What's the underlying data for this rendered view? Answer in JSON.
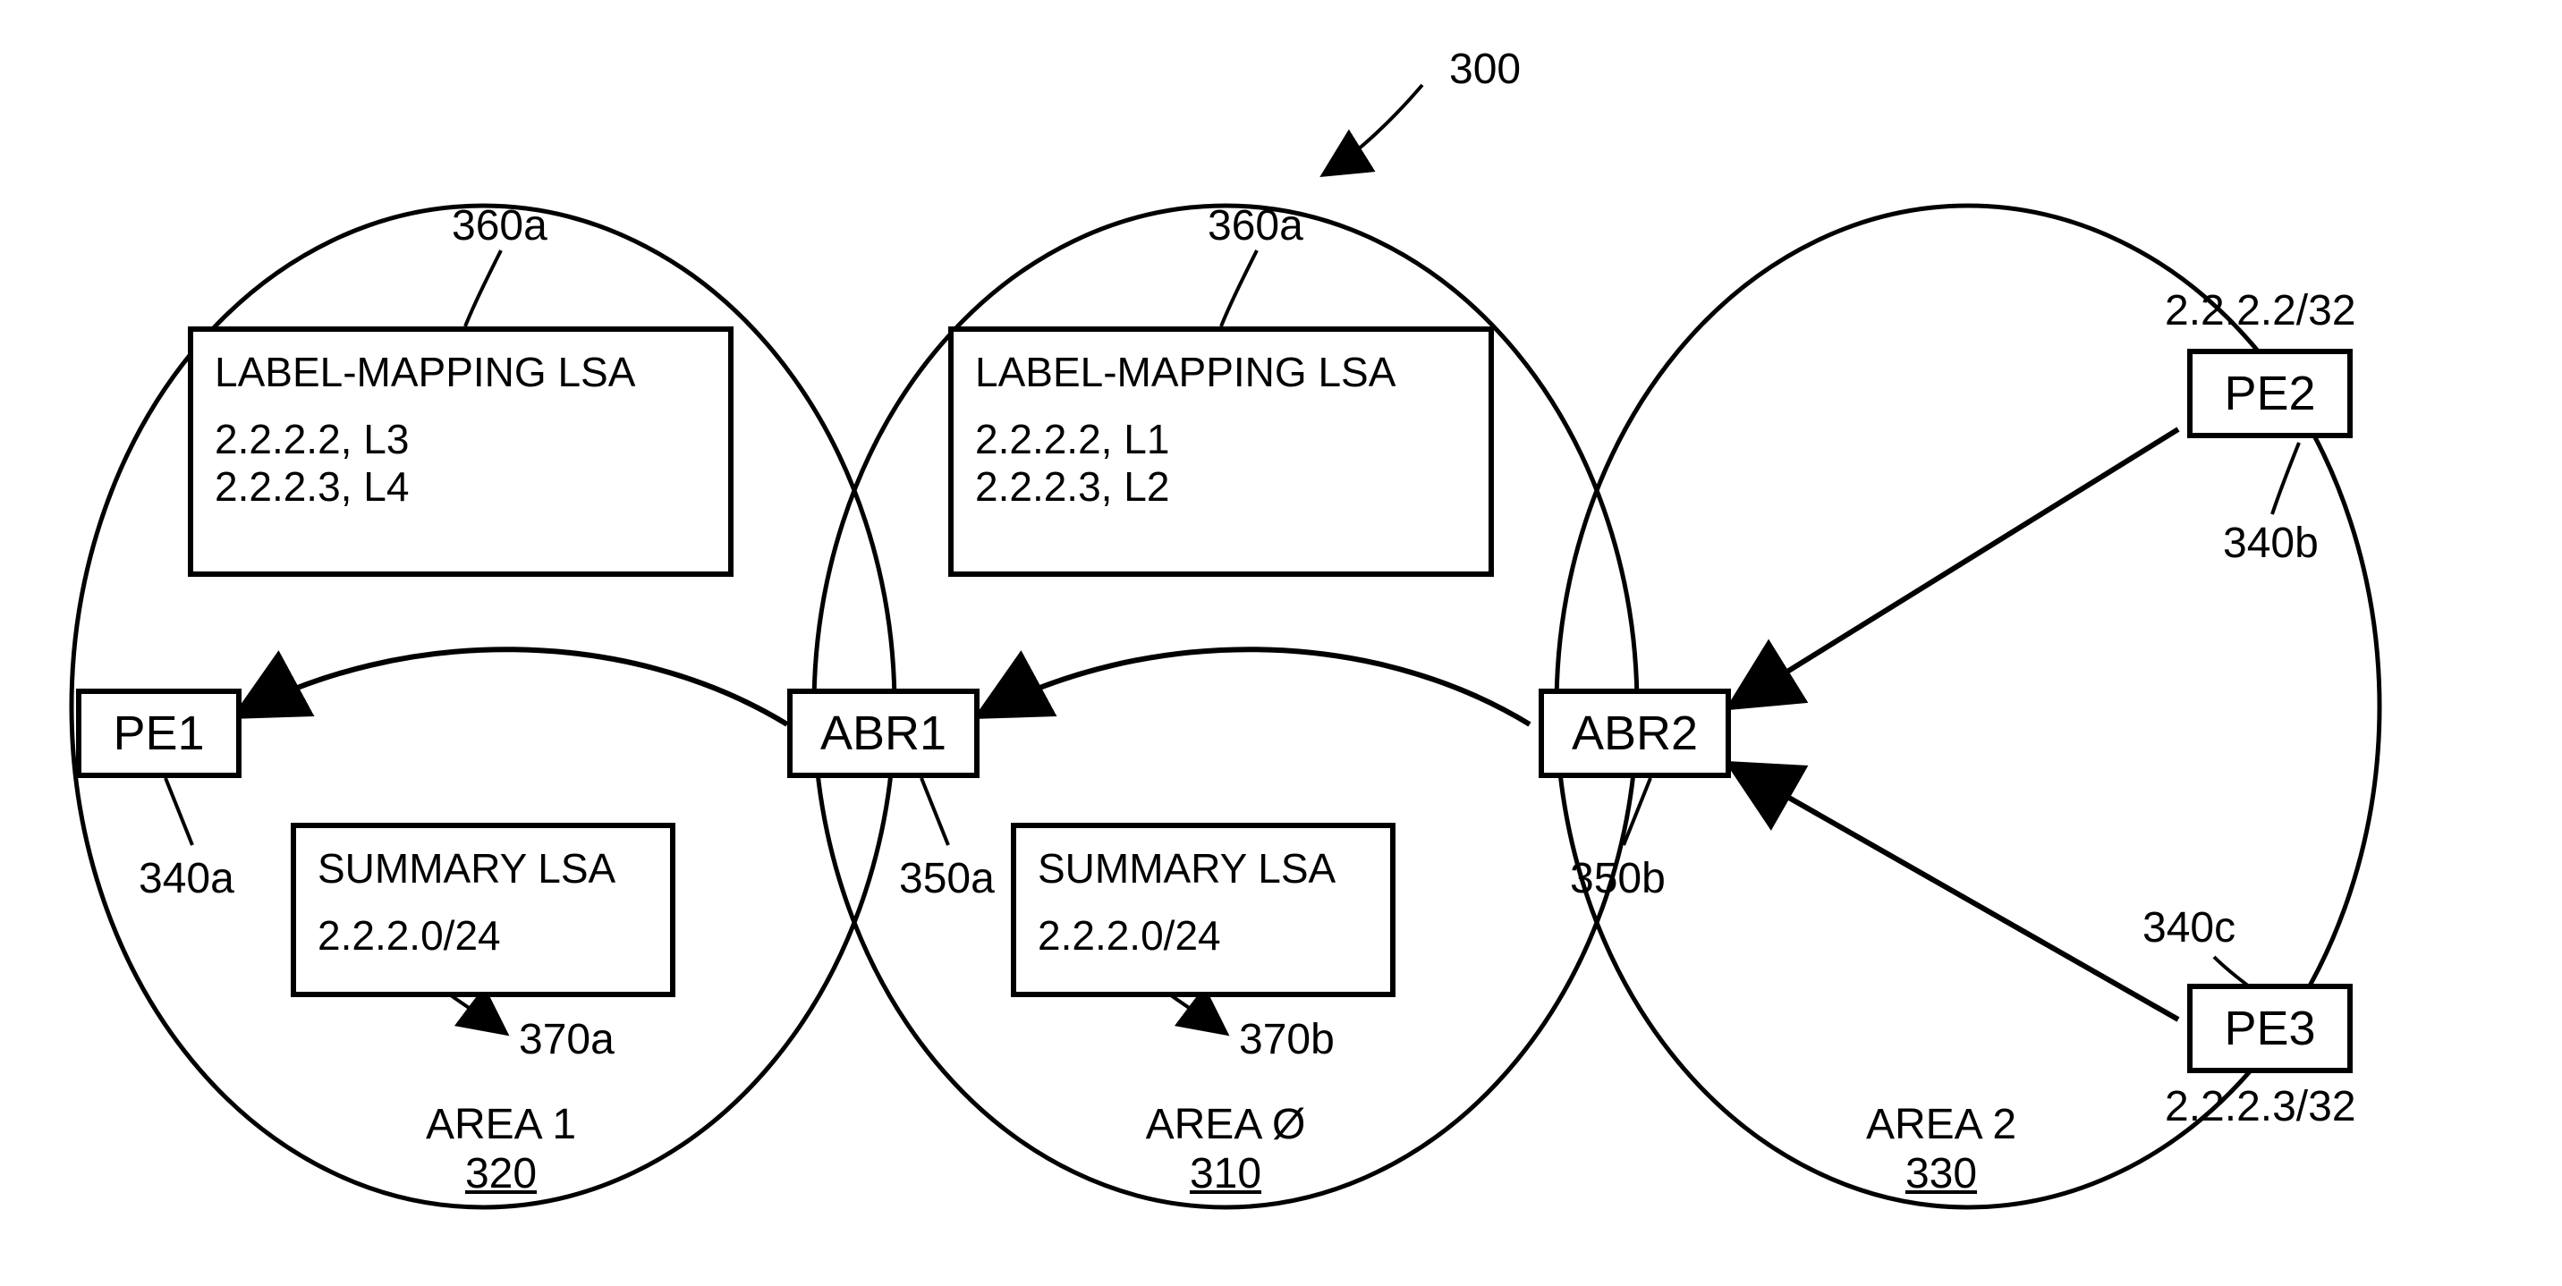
{
  "figure_id": "300",
  "areas": {
    "area1": {
      "name": "AREA 1",
      "id": "320"
    },
    "area0": {
      "name": "AREA Ø",
      "id": "310"
    },
    "area2": {
      "name": "AREA 2",
      "id": "330"
    }
  },
  "nodes": {
    "pe1": {
      "label": "PE1",
      "ref": "340a"
    },
    "abr1": {
      "label": "ABR1",
      "ref": "350a"
    },
    "abr2": {
      "label": "ABR2",
      "ref": "350b"
    },
    "pe2": {
      "label": "PE2",
      "ref": "340b",
      "ip": "2.2.2.2/32"
    },
    "pe3": {
      "label": "PE3",
      "ref": "340c",
      "ip": "2.2.2.3/32"
    }
  },
  "label_mapping_lsa": {
    "left": {
      "ref": "360a",
      "title": "LABEL-MAPPING LSA",
      "line1": "2.2.2.2, L3",
      "line2": "2.2.2.3, L4"
    },
    "mid": {
      "ref": "360a",
      "title": "LABEL-MAPPING LSA",
      "line1": "2.2.2.2, L1",
      "line2": "2.2.2.3, L2"
    }
  },
  "summary_lsa": {
    "left": {
      "ref": "370a",
      "title": "SUMMARY LSA",
      "prefix": "2.2.2.0/24"
    },
    "mid": {
      "ref": "370b",
      "title": "SUMMARY LSA",
      "prefix": "2.2.2.0/24"
    }
  }
}
